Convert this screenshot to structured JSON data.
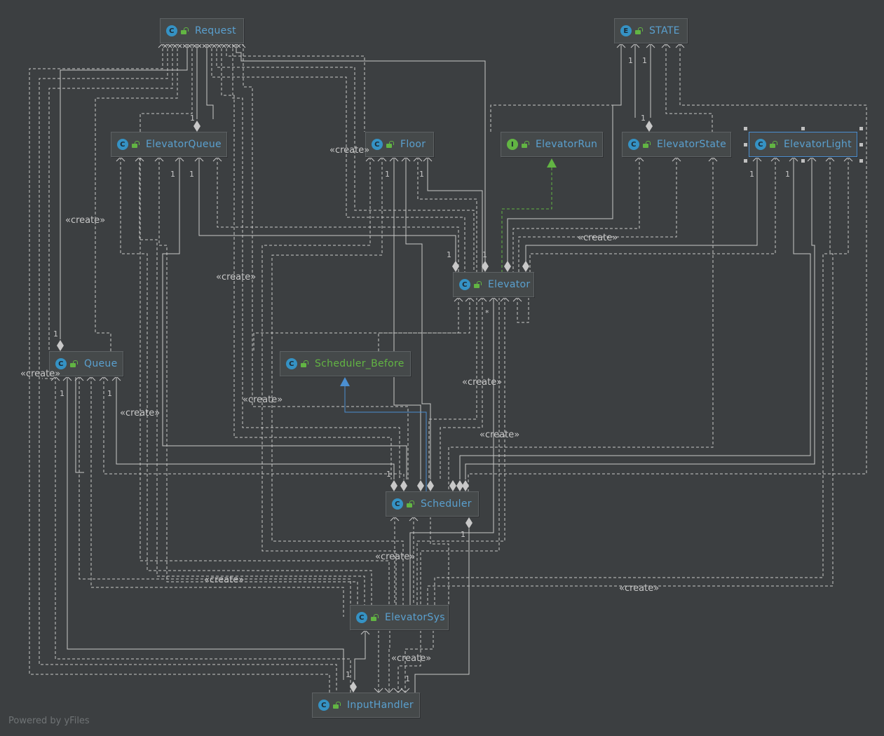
{
  "nodes": {
    "request": {
      "kind_letter": "C",
      "name": "Request"
    },
    "state": {
      "kind_letter": "E",
      "name": "STATE"
    },
    "elevatorqueue": {
      "kind_letter": "C",
      "name": "ElevatorQueue"
    },
    "floor": {
      "kind_letter": "C",
      "name": "Floor"
    },
    "elevatorrun": {
      "kind_letter": "I",
      "name": "ElevatorRun"
    },
    "elevatorstate": {
      "kind_letter": "C",
      "name": "ElevatorState"
    },
    "elevatorlight": {
      "kind_letter": "C",
      "name": "ElevatorLight"
    },
    "elevator": {
      "kind_letter": "C",
      "name": "Elevator"
    },
    "queue": {
      "kind_letter": "C",
      "name": "Queue"
    },
    "scheduler_before": {
      "kind_letter": "C",
      "name": "Scheduler_Before"
    },
    "scheduler": {
      "kind_letter": "C",
      "name": "Scheduler"
    },
    "elevatorsys": {
      "kind_letter": "C",
      "name": "ElevatorSys"
    },
    "inputhandler": {
      "kind_letter": "C",
      "name": "InputHandler"
    }
  },
  "labels": {
    "create": "«create»"
  },
  "multiplicities": {
    "one": "1",
    "many": "*"
  },
  "colors": {
    "background": "#3c3f41",
    "edge": "#c8c8c8",
    "inheritance": "#4b8fd1",
    "realization": "#62b543",
    "class_name": "#5aa0cf",
    "abstract_name": "#62b543"
  },
  "footer": "Powered by yFiles"
}
